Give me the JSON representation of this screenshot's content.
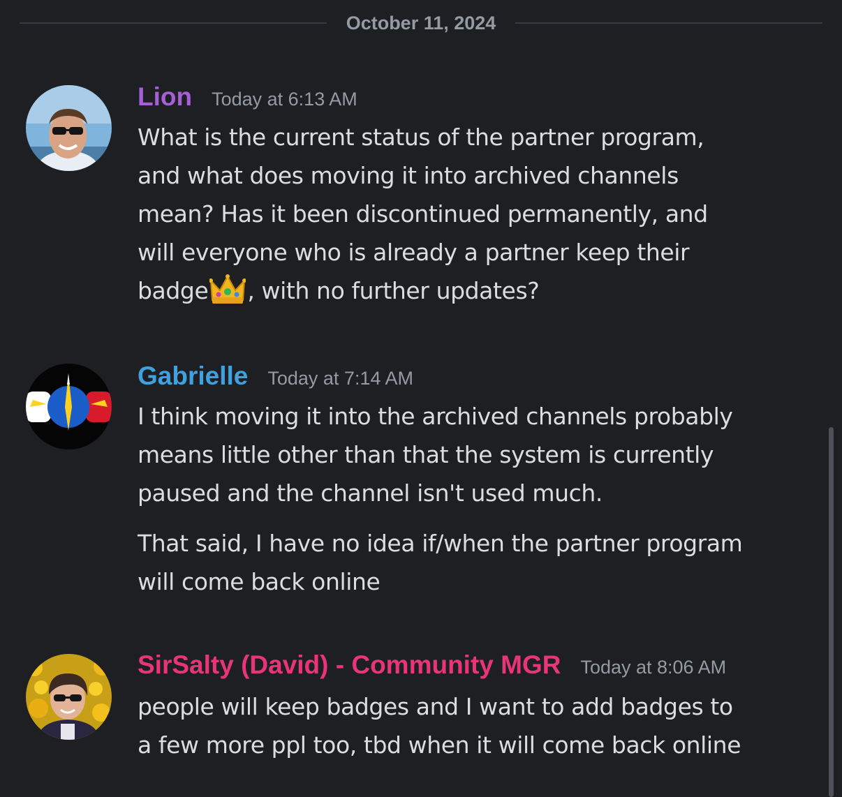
{
  "date_divider": "October 11, 2024",
  "messages": [
    {
      "username": "Lion",
      "username_color": "#a65fd6",
      "timestamp": "Today at 6:13 AM",
      "avatar_icon": "profile-photo-man-sunglasses-beach",
      "line_1": "What is the current status of the partner program,",
      "line_2": "and what does moving it into archived channels",
      "line_3": "mean? Has it been discontinued permanently, and",
      "line_4": "will everyone who is already a partner keep their",
      "line_5_before": "badge",
      "line_5_emoji": "crown-emoji",
      "line_5_after": ", with no further updates?"
    },
    {
      "username": "Gabrielle",
      "username_color": "#3ea1e0",
      "timestamp": "Today at 7:14 AM",
      "avatar_icon": "compass-emblem-avatar",
      "line_1": "I think moving it into the archived channels probably",
      "line_2": "means little other than that the system is currently",
      "line_3": "paused and the channel isn't used much.",
      "line_4": "That said, I have no idea if/when the partner program",
      "line_5": "will come back online"
    },
    {
      "username": "SirSalty (David) - Community MGR",
      "username_color": "#e8357a",
      "timestamp": "Today at 8:06 AM",
      "avatar_icon": "profile-photo-man-sunglasses-flowers",
      "line_1": "people will keep badges and I want to add badges to",
      "line_2": "a few more ppl too, tbd when it will come back online"
    }
  ]
}
